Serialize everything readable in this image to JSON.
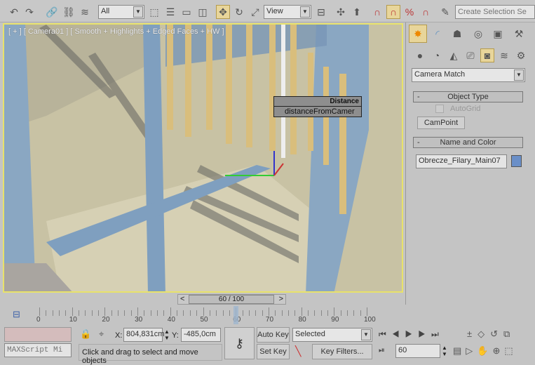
{
  "toolbar": {
    "selection_filter": "All",
    "reference_coord": "View",
    "named_selection_placeholder": "Create Selection Se",
    "icons": [
      "undo-icon",
      "redo-icon",
      "link-icon",
      "unlink-icon",
      "bind-space-warp-icon",
      "select-object-icon",
      "select-by-name-icon",
      "rect-selection-icon",
      "window-crossing-icon",
      "select-move-icon",
      "select-rotate-icon",
      "select-scale-icon",
      "pivot-icon",
      "mirror-icon",
      "align-icon",
      "snap-3d-icon",
      "angle-snap-icon",
      "percent-snap-icon",
      "spinner-snap-icon",
      "edit-named-selection-icon"
    ]
  },
  "viewport": {
    "label": "[ + ] [ Camera01 ] [ Smooth + Highlights + Edged Faces + HW ]",
    "tooltip_title": "Distance",
    "tooltip_value": "distanceFromCamer",
    "active_border_color": "#e8e26a"
  },
  "command_panel": {
    "tabs": [
      "create-tab",
      "modify-tab",
      "hierarchy-tab",
      "motion-tab",
      "display-tab",
      "utilities-tab"
    ],
    "categories": [
      "geometry",
      "shapes",
      "lights",
      "cameras",
      "helpers",
      "space-warps",
      "systems"
    ],
    "category_dropdown": "Camera Match",
    "object_type": {
      "title": "Object Type",
      "autogrid_label": "AutoGrid",
      "autogrid_checked": false,
      "campoint_label": "CamPoint"
    },
    "name_and_color": {
      "title": "Name and Color",
      "name": "Obrecze_Filary_Main07",
      "color": "#6a8fc8"
    }
  },
  "time_slider": {
    "label": "60 / 100",
    "current": 60,
    "total": 100
  },
  "timeline": {
    "ticks": [
      "0",
      "10",
      "20",
      "30",
      "40",
      "50",
      "60",
      "70",
      "80",
      "90",
      "100"
    ]
  },
  "status": {
    "maxscript_placeholder": "MAXScript Mi",
    "x_label": "X:",
    "x_value": "804,831cm",
    "y_label": "Y:",
    "y_value": "-485,0cm",
    "prompt": "Click and drag to select and move objects"
  },
  "anim": {
    "auto_key": "Auto Key",
    "set_key": "Set Key",
    "key_mode": "Selected",
    "key_filters": "Key Filters...",
    "frame": "60"
  }
}
